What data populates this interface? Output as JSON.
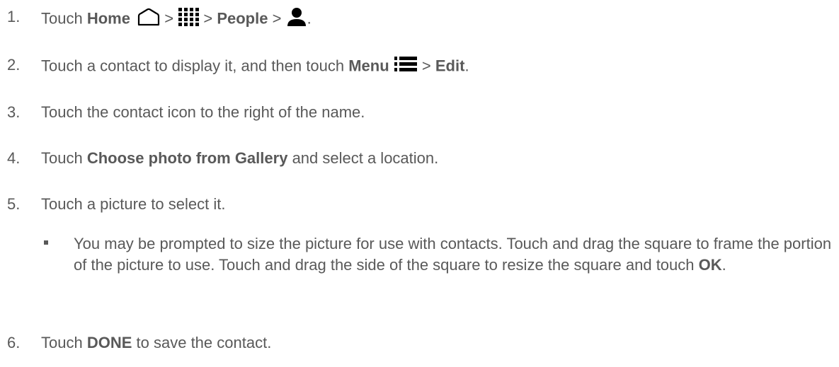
{
  "steps": [
    {
      "number": "1.",
      "touch": "Touch",
      "home": "Home",
      "sep1": ">",
      "sep2": ">",
      "people": "People",
      "sep3": ">",
      "end": "."
    },
    {
      "number": "2.",
      "pre": "Touch a contact to display it, and then touch",
      "menu": "Menu",
      "sep": ">",
      "edit": "Edit",
      "end": "."
    },
    {
      "number": "3.",
      "text": "Touch the contact icon to the right of the name."
    },
    {
      "number": "4.",
      "touch": "Touch",
      "choose": "Choose photo from Gallery",
      "post": "and select a location."
    },
    {
      "number": "5.",
      "text": "Touch a picture to select it."
    },
    {
      "number": "6.",
      "touch": "Touch",
      "done": "DONE",
      "post": "to save the contact."
    }
  ],
  "bullet": {
    "text": "You may be prompted to size the picture for use with contacts. Touch and drag the square to frame the portion of the picture to use. Touch and drag the side of the square to resize the square and touch",
    "ok": "OK",
    "end": "."
  },
  "icons": [
    "home-icon",
    "apps-grid-icon",
    "person-icon",
    "menu-icon"
  ],
  "colors": {
    "text": "#595959",
    "icon": "#000000"
  }
}
